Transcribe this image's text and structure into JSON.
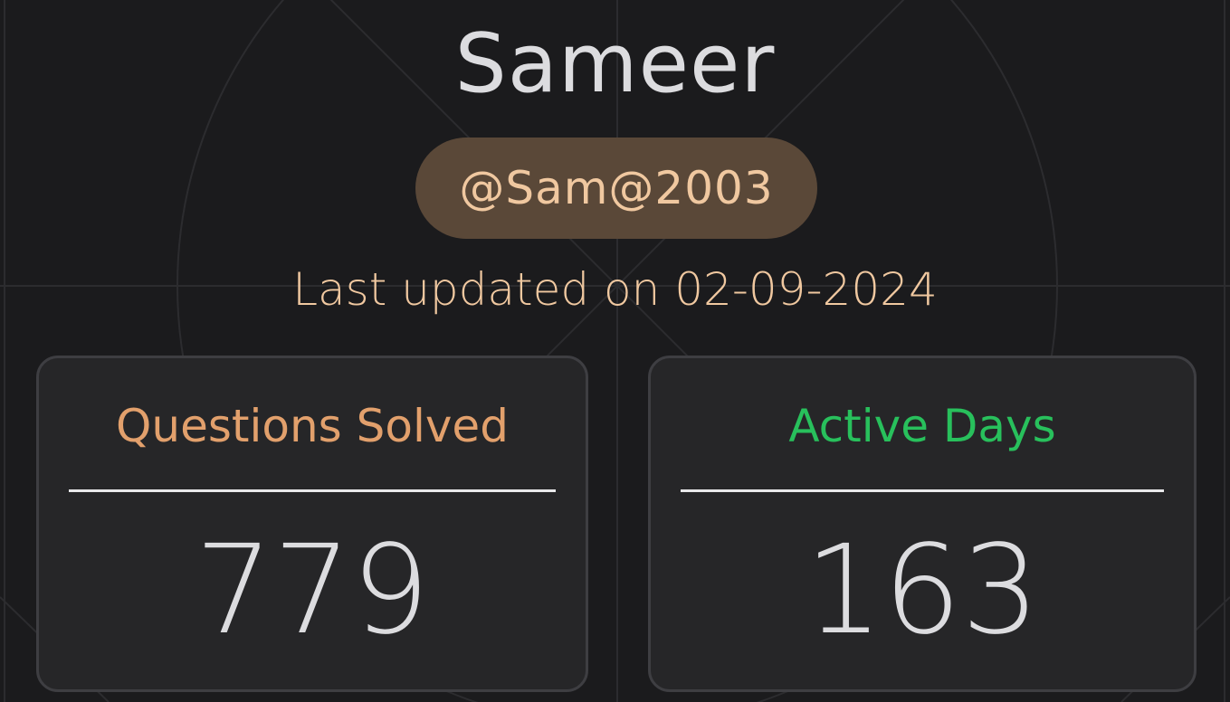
{
  "profile": {
    "name": "Sameer",
    "handle": "@Sam@2003",
    "last_updated": "Last updated on 02-09-2024"
  },
  "stats": {
    "questions": {
      "label": "Questions Solved",
      "value": "779"
    },
    "active_days": {
      "label": "Active Days",
      "value": "163"
    }
  },
  "colors": {
    "background": "#1b1b1d",
    "handle_pill": "#5a4838",
    "accent_peach": "#f0c8a0",
    "questions_label": "#e2a06c",
    "active_days_label": "#28c05c",
    "value_text": "#dcdcdf"
  }
}
